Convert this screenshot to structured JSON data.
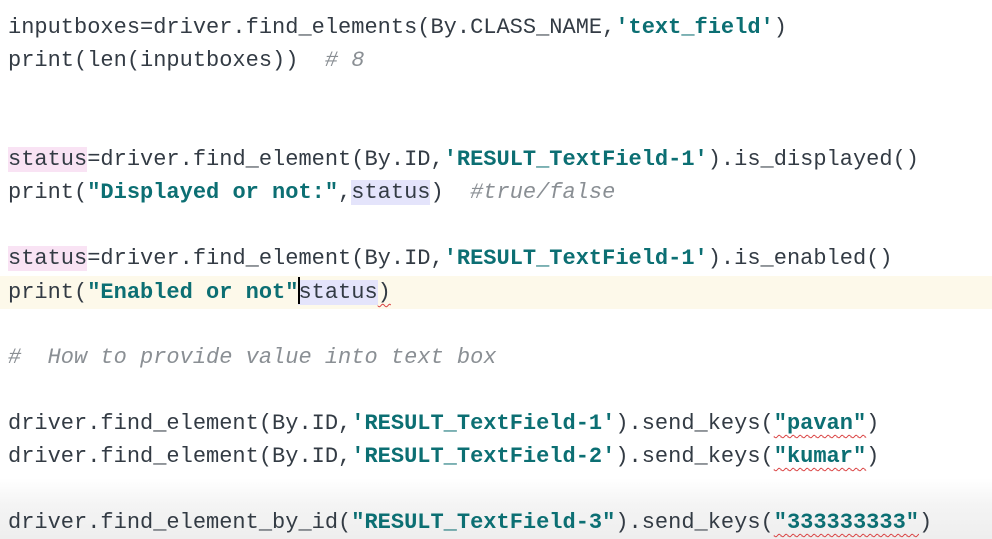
{
  "editor": {
    "lines": [
      {
        "segments": [
          {
            "text": "inputboxes=driver.find_elements(By.CLASS_NAME,",
            "kind": "code"
          },
          {
            "text": "'text_field'",
            "kind": "string"
          },
          {
            "text": ")",
            "kind": "code"
          }
        ]
      },
      {
        "segments": [
          {
            "text": "print(len(inputboxes))  ",
            "kind": "code"
          },
          {
            "text": "# 8",
            "kind": "comment"
          }
        ]
      },
      {
        "segments": [
          {
            "text": "status",
            "kind": "highlight-pink"
          },
          {
            "text": "=driver.find_element(By.ID,",
            "kind": "code"
          },
          {
            "text": "'RESULT_TextField-1'",
            "kind": "string"
          },
          {
            "text": ").is_displayed()",
            "kind": "code"
          }
        ]
      },
      {
        "segments": [
          {
            "text": "print(",
            "kind": "code"
          },
          {
            "text": "\"Displayed or not:\"",
            "kind": "string"
          },
          {
            "text": ",",
            "kind": "code"
          },
          {
            "text": "status",
            "kind": "highlight-lavender"
          },
          {
            "text": ")  ",
            "kind": "code"
          },
          {
            "text": "#true/false",
            "kind": "comment"
          }
        ]
      },
      {
        "segments": [
          {
            "text": "status",
            "kind": "highlight-pink"
          },
          {
            "text": "=driver.find_element(By.ID,",
            "kind": "code"
          },
          {
            "text": "'RESULT_TextField-1'",
            "kind": "string"
          },
          {
            "text": ").is_enabled()",
            "kind": "code"
          }
        ]
      },
      {
        "segments": [
          {
            "text": "print(",
            "kind": "code"
          },
          {
            "text": "\"Enabled or not\"",
            "kind": "string"
          },
          {
            "text": "status",
            "kind": "highlight-lavender"
          },
          {
            "text": ")",
            "kind": "code"
          }
        ]
      },
      {
        "segments": [
          {
            "text": "#  How to provide value into text box",
            "kind": "comment"
          }
        ]
      },
      {
        "segments": [
          {
            "text": "driver.find_element(By.ID,",
            "kind": "code"
          },
          {
            "text": "'RESULT_TextField-1'",
            "kind": "string"
          },
          {
            "text": ").send_keys(",
            "kind": "code"
          },
          {
            "text": "\"pavan\"",
            "kind": "string"
          },
          {
            "text": ")",
            "kind": "code"
          }
        ]
      },
      {
        "segments": [
          {
            "text": "driver.find_element(By.ID,",
            "kind": "code"
          },
          {
            "text": "'RESULT_TextField-2'",
            "kind": "string"
          },
          {
            "text": ").send_keys(",
            "kind": "code"
          },
          {
            "text": "\"kumar\"",
            "kind": "string"
          },
          {
            "text": ")",
            "kind": "code"
          }
        ]
      },
      {
        "segments": [
          {
            "text": "driver.find_element_by_id(",
            "kind": "code"
          },
          {
            "text": "\"RESULT_TextField-3\"",
            "kind": "string"
          },
          {
            "text": ").send_keys(",
            "kind": "code"
          },
          {
            "text": "\"333333333\"",
            "kind": "string"
          },
          {
            "text": ")",
            "kind": "code"
          }
        ]
      }
    ]
  },
  "colors": {
    "code": "#333b44",
    "string": "#0c6f73",
    "comment": "#8a8f94",
    "highlight_pink": "#f9e3f4",
    "highlight_lavender": "#e4e4fb",
    "current_line": "#fdf9ea"
  }
}
